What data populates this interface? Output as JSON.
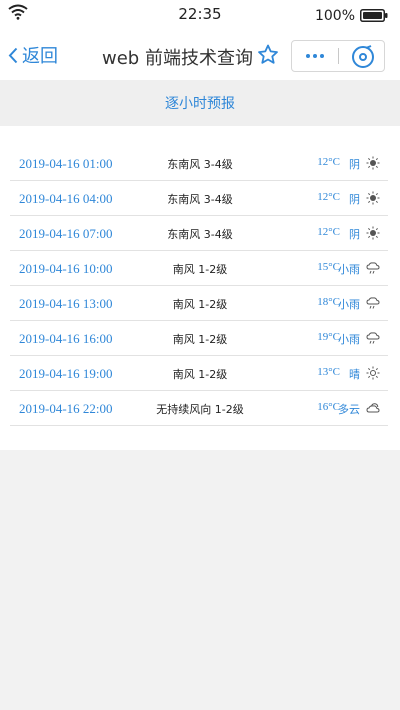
{
  "status_bar": {
    "time": "22:35",
    "battery": "100%",
    "icons": [
      "wifi-icon",
      "battery-icon"
    ]
  },
  "nav": {
    "back_label": "返回",
    "title": "web 前端技术查询",
    "icons": [
      "chevron-left-icon",
      "star-icon",
      "more-icon",
      "close-target-icon"
    ]
  },
  "section": {
    "title": "逐小时预报"
  },
  "forecast": [
    {
      "time": "2019-04-16 01:00",
      "wind": "东南风 3-4级",
      "temp": "12°C",
      "weather": "阴",
      "icon": "overcast-icon"
    },
    {
      "time": "2019-04-16 04:00",
      "wind": "东南风 3-4级",
      "temp": "12°C",
      "weather": "阴",
      "icon": "overcast-icon"
    },
    {
      "time": "2019-04-16 07:00",
      "wind": "东南风 3-4级",
      "temp": "12°C",
      "weather": "阴",
      "icon": "overcast-icon"
    },
    {
      "time": "2019-04-16 10:00",
      "wind": "南风 1-2级",
      "temp": "15°C",
      "weather": "小雨",
      "icon": "light-rain-icon"
    },
    {
      "time": "2019-04-16 13:00",
      "wind": "南风 1-2级",
      "temp": "18°C",
      "weather": "小雨",
      "icon": "light-rain-icon"
    },
    {
      "time": "2019-04-16 16:00",
      "wind": "南风 1-2级",
      "temp": "19°C",
      "weather": "小雨",
      "icon": "light-rain-icon"
    },
    {
      "time": "2019-04-16 19:00",
      "wind": "南风 1-2级",
      "temp": "13°C",
      "weather": "晴",
      "icon": "sunny-icon"
    },
    {
      "time": "2019-04-16 22:00",
      "wind": "无持续风向 1-2级",
      "temp": "16°C",
      "weather": "多云",
      "icon": "cloudy-icon"
    }
  ],
  "colors": {
    "accent": "#2f87d8",
    "background": "#f2f2f2",
    "surface": "#ffffff",
    "divider": "#e2e2e2"
  }
}
